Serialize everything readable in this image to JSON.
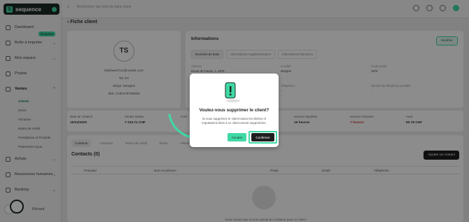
{
  "brand": {
    "name": "sequence"
  },
  "topbar": {
    "search_placeholder": "Rechercher par nom de dans client",
    "filter_label": "C"
  },
  "sidebar": {
    "items": [
      {
        "label": "Dashboard"
      },
      {
        "label": "Boîte à importer",
        "badge": "Nouveau"
      },
      {
        "label": "Mon espace"
      },
      {
        "label": "Projets"
      },
      {
        "label": "Ventes"
      },
      {
        "label": "Achats"
      },
      {
        "label": "Ressources humaines"
      },
      {
        "label": "Banking"
      }
    ],
    "sub_items": [
      "Clients",
      "Devis",
      "Factures",
      "Notes de crédit",
      "Prestations et Produits",
      "Paiements reçus"
    ],
    "user_name": "Richard"
  },
  "page": {
    "title": "Fiche client"
  },
  "client_card": {
    "initials": "TS",
    "email": "bidebee2711@roasts.com",
    "company": "Tor SA",
    "seat": "Siège: Morgins",
    "ide": "IDE: CHE476708099"
  },
  "info": {
    "title": "Informations",
    "modify_label": "Modifier",
    "tabs": [
      "Données de base",
      "Informations supplémentaires",
      "Informations bancaires"
    ],
    "fields": [
      {
        "label": "Adresse",
        "value": "Route de France, 2, 1875"
      },
      {
        "label": "Localité",
        "value": "Morgins"
      },
      {
        "label": "Code postal",
        "value": "1875"
      },
      {
        "label": "Téléphone",
        "value": "-"
      },
      {
        "label": "Numéro de téléphone portable",
        "value": "-"
      }
    ]
  },
  "stats": [
    {
      "label": "Date de création",
      "value": "15/12/2025"
    },
    {
      "label": "Ventes totales",
      "value": "7 233.71 CHF"
    },
    {
      "label": "Créé",
      "value": ""
    },
    {
      "label": "Heures imputées",
      "value": "19 heures"
    },
    {
      "label": "Heures à facturer",
      "value": "7 heures"
    },
    {
      "label": "Avoir",
      "value": "60.78 CHF"
    }
  ],
  "lower": {
    "tabs": [
      "Contacts",
      "Factures",
      "Notes de crédit",
      "Devis",
      "Historique"
    ],
    "contacts_title": "Contacts (0)",
    "add_contact_label": "Ajouter un contact",
    "columns": [
      "Principal",
      "Nom et prénom",
      "Poste",
      "Email",
      "Téléphone"
    ],
    "empty_text": "Vous n'avez pas encore ajouté de contacts pour ce client"
  },
  "modal": {
    "title": "Voulez-vous supprimer le client?",
    "text": "Si vous supprimez le client toutes les tâches et imputations liées à ce client seront supprimées.",
    "cancel_label": "Annuler",
    "confirm_label": "Confirmer"
  },
  "colors": {
    "accent": "#3fd9a4",
    "dark": "#1e1e1e",
    "danger": "#d43c3c"
  }
}
